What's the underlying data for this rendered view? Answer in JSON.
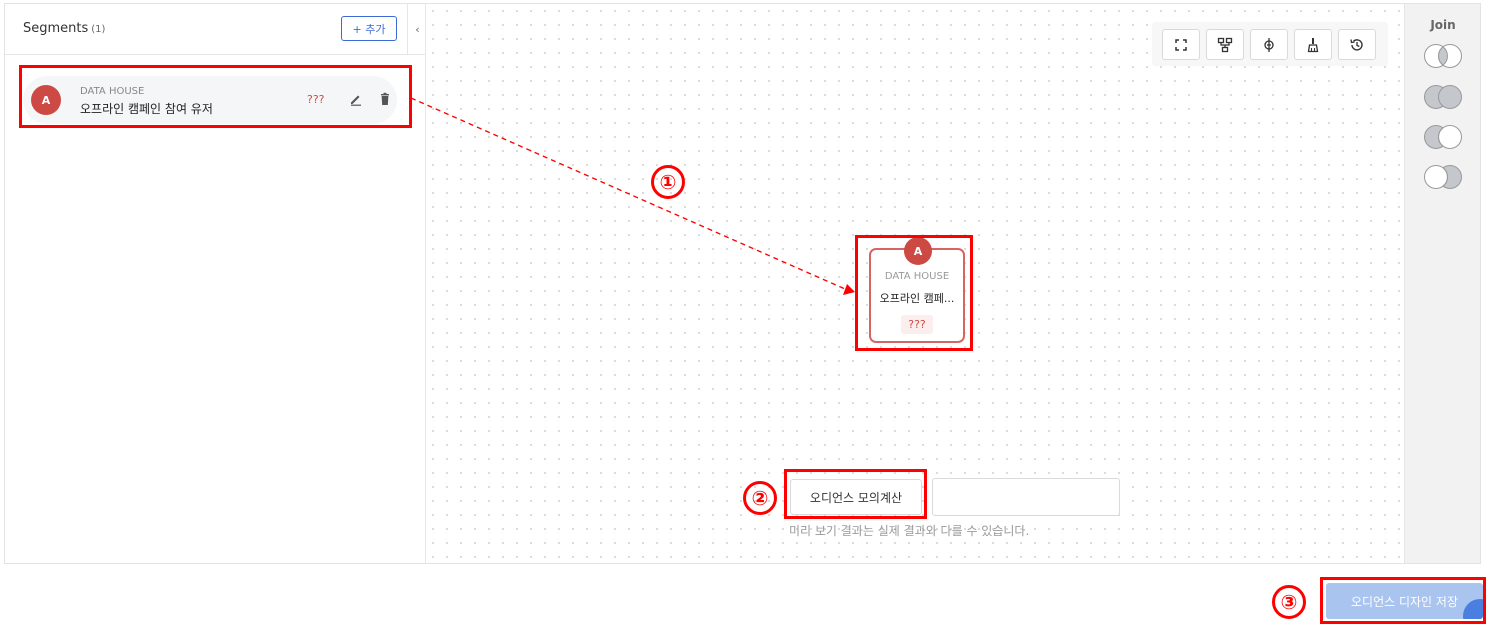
{
  "left_panel": {
    "title": "Segments",
    "count": "(1)",
    "add_button": "+ 추가",
    "collapse_glyph": "‹",
    "segment": {
      "avatar": "A",
      "source": "DATA HOUSE",
      "name": "오프라인 캠페인 참여 유저",
      "count": "???"
    }
  },
  "toolbar": {
    "icons": [
      "fit-screen-icon",
      "hierarchy-icon",
      "align-center-icon",
      "clean-icon",
      "history-icon"
    ]
  },
  "node": {
    "avatar": "A",
    "source": "DATA HOUSE",
    "name": "오프라인 캠페...",
    "count": "???"
  },
  "simulation": {
    "button": "오디언스 모의계산",
    "note": "미리 보기 결과는 실제 결과와 다를 수 있습니다."
  },
  "join_panel": {
    "title": "Join",
    "options": [
      "intersection-join-icon",
      "union-join-icon",
      "left-exclusive-join-icon",
      "right-exclusive-join-icon"
    ]
  },
  "save_button": "오디언스 디자인 저장",
  "annotations": {
    "step1": "①",
    "step2": "②",
    "step3": "③"
  },
  "colors": {
    "accent": "#3d6bd6",
    "avatar": "#cc4a43",
    "annotation": "#ff0000",
    "save_button": "#a9c4ef"
  }
}
